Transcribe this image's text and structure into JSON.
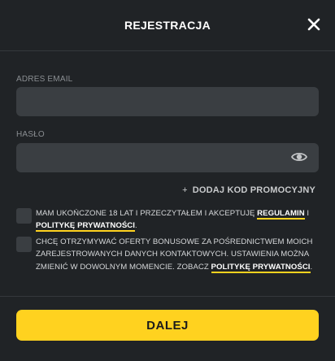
{
  "modal": {
    "title": "REJESTRACJA"
  },
  "email": {
    "label": "ADRES EMAIL",
    "value": "",
    "placeholder": ""
  },
  "password": {
    "label": "HASŁO",
    "value": "",
    "placeholder": ""
  },
  "promo": {
    "plus": "+",
    "label": "DODAJ KOD PROMOCYJNY"
  },
  "consent1": {
    "text_before": "MAM UKOŃCZONE 18 LAT I PRZECZYTAŁEM I AKCEPTUJĘ ",
    "link_terms": "REGULAMIN",
    "text_middle": " I ",
    "link_privacy": "POLITYKĘ PRYWATNOŚCI",
    "text_after": ".",
    "checked": false
  },
  "consent2": {
    "text_before": "CHCĘ OTRZYMYWAĆ OFERTY BONUSOWE ZA POŚREDNICTWEM MOICH ZAREJESTROWANYCH DANYCH KONTAKTOWYCH. USTAWIENIA MOŻNA ZMIENIĆ W DOWOLNYM MOMENCIE. ZOBACZ ",
    "link_privacy": "POLITYKĘ PRYWATNOŚCI",
    "text_after": ".",
    "checked": false
  },
  "submit": {
    "label": "DALEJ"
  },
  "colors": {
    "background": "#202326",
    "input_bg": "#3a3e42",
    "accent": "#ffd21f",
    "label": "#8a8e92"
  },
  "icons": {
    "close": "close-icon",
    "eye": "eye-icon"
  }
}
